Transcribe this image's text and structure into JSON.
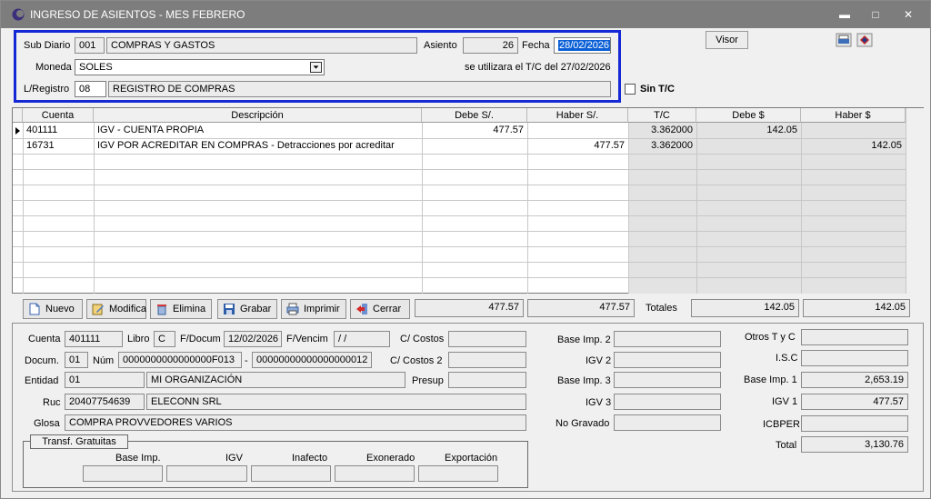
{
  "window": {
    "title": "INGRESO DE ASIENTOS - MES FEBRERO",
    "minimize": "▬",
    "maximize": "□",
    "close": "✕"
  },
  "header": {
    "subdiario_label": "Sub Diario",
    "subdiario_code": "001",
    "subdiario_name": "COMPRAS Y GASTOS",
    "asiento_label": "Asiento",
    "asiento_value": "26",
    "fecha_label": "Fecha",
    "fecha_value": "28/02/2026",
    "moneda_label": "Moneda",
    "moneda_value": "SOLES",
    "tc_note": "se utilizara el T/C del 27/02/2026",
    "lregistro_label": "L/Registro",
    "lregistro_code": "08",
    "lregistro_name": "REGISTRO DE COMPRAS",
    "visor_label": "Visor",
    "sin_tc_label": "Sin T/C"
  },
  "grid": {
    "columns": [
      "Cuenta",
      "Descripción",
      "Debe S/.",
      "Haber S/.",
      "T/C",
      "Debe $",
      "Haber $"
    ],
    "rows": [
      {
        "cuenta": "401111",
        "descripcion": "IGV - CUENTA PROPIA",
        "debe_s": "477.57",
        "haber_s": "",
        "tc": "3.362000",
        "debe_d": "142.05",
        "haber_d": ""
      },
      {
        "cuenta": "16731",
        "descripcion": "IGV POR ACREDITAR EN COMPRAS - Detracciones por acreditar",
        "debe_s": "",
        "haber_s": "477.57",
        "tc": "3.362000",
        "debe_d": "",
        "haber_d": "142.05"
      }
    ]
  },
  "toolbar": {
    "nuevo": "Nuevo",
    "modifica": "Modifica",
    "elimina": "Elimina",
    "grabar": "Grabar",
    "imprimir": "Imprimir",
    "cerrar": "Cerrar"
  },
  "totals": {
    "debe_s": "477.57",
    "haber_s": "477.57",
    "label": "Totales",
    "debe_d": "142.05",
    "haber_d": "142.05"
  },
  "detail": {
    "cuenta_label": "Cuenta",
    "cuenta_value": "401111",
    "libro_label": "Libro",
    "libro_value": "C",
    "fdocum_label": "F/Docum",
    "fdocum_value": "12/02/2026",
    "fvencim_label": "F/Vencim",
    "fvencim_value": " /  /",
    "ccostos_label": "C/ Costos",
    "docum_label": "Docum.",
    "docum_value": "01",
    "num_label": "Núm",
    "num_serie": "0000000000000000F013",
    "num_dash": "-",
    "num_numero": "00000000000000000012",
    "ccostos2_label": "C/ Costos 2",
    "entidad_label": "Entidad",
    "entidad_code": "01",
    "entidad_name": "MI ORGANIZACIÓN",
    "presup_label": "Presup",
    "ruc_label": "Ruc",
    "ruc_value": "20407754639",
    "ruc_name": "ELECONN SRL",
    "glosa_label": "Glosa",
    "glosa_value": "COMPRA PROVVEDORES VARIOS",
    "base_imp2_label": "Base Imp. 2",
    "igv2_label": "IGV 2",
    "base_imp3_label": "Base Imp. 3",
    "igv3_label": "IGV 3",
    "no_gravado_label": "No Gravado",
    "otros_label": "Otros T y C",
    "isc_label": "I.S.C",
    "base_imp1_label": "Base Imp. 1",
    "base_imp1_value": "2,653.19",
    "igv1_label": "IGV 1",
    "igv1_value": "477.57",
    "icbper_label": "ICBPER",
    "total_label": "Total",
    "total_value": "3,130.76"
  },
  "gratuitas": {
    "title": "Transf. Gratuitas",
    "base": "Base Imp.",
    "igv": "IGV",
    "inafecto": "Inafecto",
    "exonerado": "Exonerado",
    "exportacion": "Exportación"
  }
}
